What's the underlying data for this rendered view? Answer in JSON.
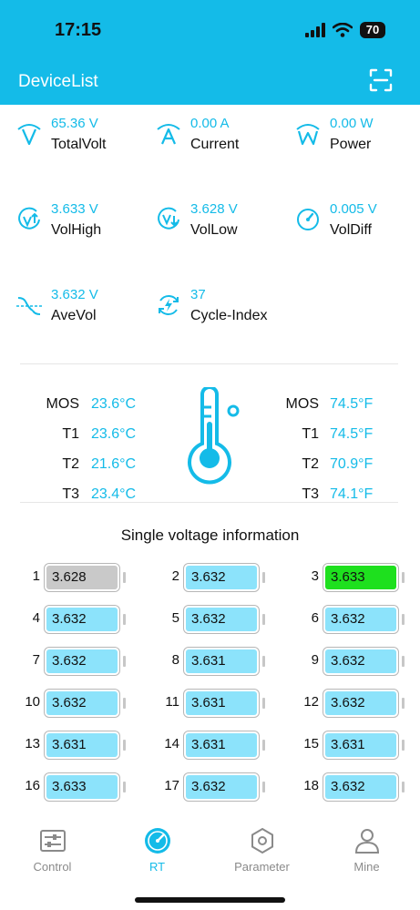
{
  "status": {
    "time": "17:15",
    "battery": "70"
  },
  "nav": {
    "title": "DeviceList",
    "scan_icon": "scan-icon"
  },
  "metrics": [
    {
      "value": "65.36 V",
      "label": "TotalVolt",
      "icon": "total-volt-icon"
    },
    {
      "value": "0.00 A",
      "label": "Current",
      "icon": "current-icon"
    },
    {
      "value": "0.00 W",
      "label": "Power",
      "icon": "power-icon"
    },
    {
      "value": "3.633 V",
      "label": "VolHigh",
      "icon": "vol-high-icon"
    },
    {
      "value": "3.628 V",
      "label": "VolLow",
      "icon": "vol-low-icon"
    },
    {
      "value": "0.005 V",
      "label": "VolDiff",
      "icon": "vol-diff-icon"
    },
    {
      "value": "3.632 V",
      "label": "AveVol",
      "icon": "ave-vol-icon"
    },
    {
      "value": "37",
      "label": "Cycle-Index",
      "icon": "cycle-index-icon"
    }
  ],
  "temps": {
    "celsius": [
      {
        "name": "MOS",
        "value": "23.6°C"
      },
      {
        "name": "T1",
        "value": "23.6°C"
      },
      {
        "name": "T2",
        "value": "21.6°C"
      },
      {
        "name": "T3",
        "value": "23.4°C"
      }
    ],
    "fahrenheit": [
      {
        "name": "MOS",
        "value": "74.5°F"
      },
      {
        "name": "T1",
        "value": "74.5°F"
      },
      {
        "name": "T2",
        "value": "70.9°F"
      },
      {
        "name": "T3",
        "value": "74.1°F"
      }
    ]
  },
  "single": {
    "title": "Single voltage information",
    "cells": [
      {
        "index": "1",
        "value": "3.628",
        "state": "low"
      },
      {
        "index": "2",
        "value": "3.632",
        "state": "normal"
      },
      {
        "index": "3",
        "value": "3.633",
        "state": "high"
      },
      {
        "index": "4",
        "value": "3.632",
        "state": "normal"
      },
      {
        "index": "5",
        "value": "3.632",
        "state": "normal"
      },
      {
        "index": "6",
        "value": "3.632",
        "state": "normal"
      },
      {
        "index": "7",
        "value": "3.632",
        "state": "normal"
      },
      {
        "index": "8",
        "value": "3.631",
        "state": "normal"
      },
      {
        "index": "9",
        "value": "3.632",
        "state": "normal"
      },
      {
        "index": "10",
        "value": "3.632",
        "state": "normal"
      },
      {
        "index": "11",
        "value": "3.631",
        "state": "normal"
      },
      {
        "index": "12",
        "value": "3.632",
        "state": "normal"
      },
      {
        "index": "13",
        "value": "3.631",
        "state": "normal"
      },
      {
        "index": "14",
        "value": "3.631",
        "state": "normal"
      },
      {
        "index": "15",
        "value": "3.631",
        "state": "normal"
      },
      {
        "index": "16",
        "value": "3.633",
        "state": "normal"
      },
      {
        "index": "17",
        "value": "3.632",
        "state": "normal"
      },
      {
        "index": "18",
        "value": "3.632",
        "state": "normal"
      }
    ],
    "state_colors": {
      "low": "#c9c9c9",
      "normal": "#8ce3fb",
      "high": "#1ee01e"
    }
  },
  "tabs": [
    {
      "label": "Control",
      "icon": "control-icon",
      "active": false
    },
    {
      "label": "RT",
      "icon": "rt-gauge-icon",
      "active": true
    },
    {
      "label": "Parameter",
      "icon": "parameter-icon",
      "active": false
    },
    {
      "label": "Mine",
      "icon": "mine-person-icon",
      "active": false
    }
  ],
  "colors": {
    "accent": "#14bbe8",
    "text": "#111111",
    "tab_inactive": "#8a8a8a"
  }
}
